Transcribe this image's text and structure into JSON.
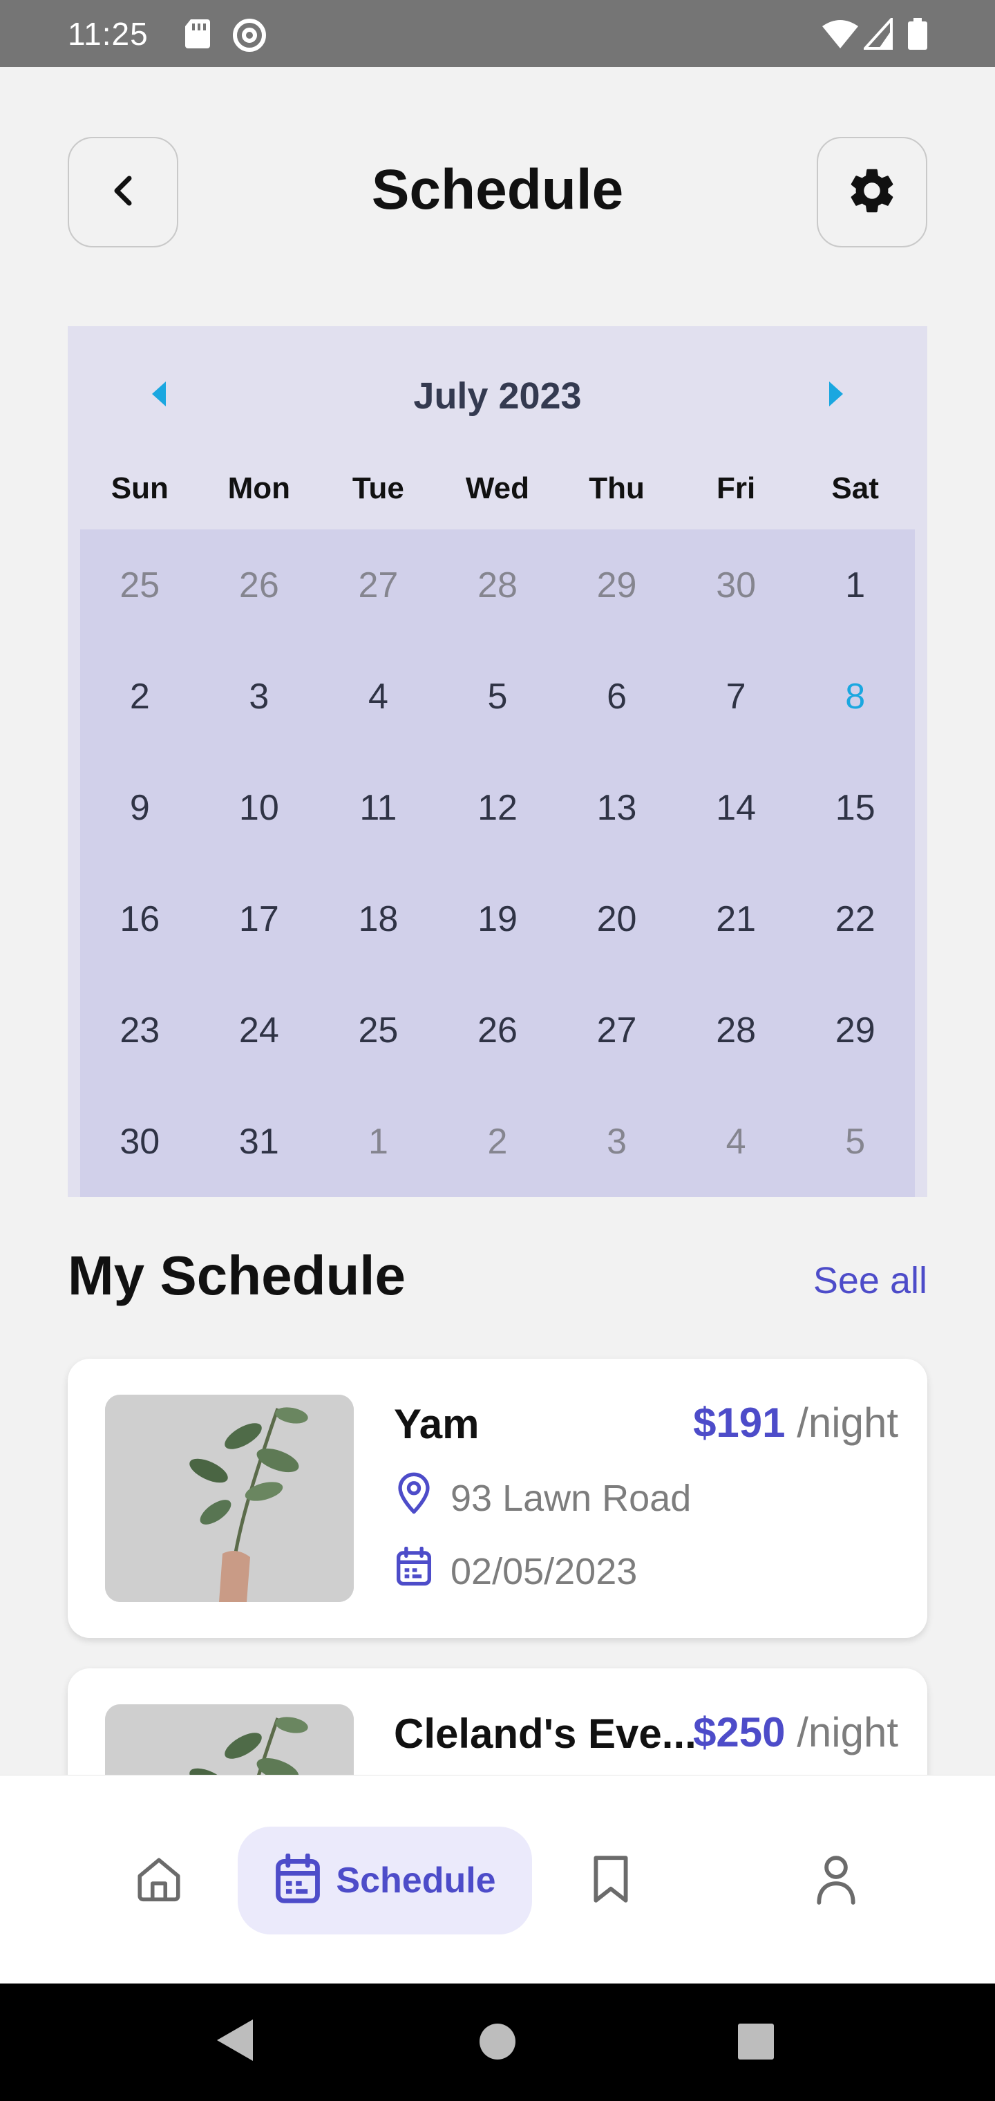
{
  "status_bar": {
    "time": "11:25"
  },
  "header": {
    "title": "Schedule"
  },
  "calendar": {
    "month_label": "July 2023",
    "weekdays": [
      "Sun",
      "Mon",
      "Tue",
      "Wed",
      "Thu",
      "Fri",
      "Sat"
    ],
    "days": [
      [
        "25",
        "26",
        "27",
        "28",
        "29",
        "30",
        "1"
      ],
      [
        "2",
        "3",
        "4",
        "5",
        "6",
        "7",
        "8"
      ],
      [
        "9",
        "10",
        "11",
        "12",
        "13",
        "14",
        "15"
      ],
      [
        "16",
        "17",
        "18",
        "19",
        "20",
        "21",
        "22"
      ],
      [
        "23",
        "24",
        "25",
        "26",
        "27",
        "28",
        "29"
      ],
      [
        "30",
        "31",
        "1",
        "2",
        "3",
        "4",
        "5"
      ]
    ],
    "today": "8",
    "accent_color": "#1aa7e0"
  },
  "my_schedule": {
    "title": "My Schedule",
    "see_all": "See all",
    "items": [
      {
        "name": "Yam",
        "price": "$191",
        "unit": "/night",
        "address": "93 Lawn Road",
        "date": "02/05/2023"
      },
      {
        "name": "Cleland's Eve...",
        "price": "$250",
        "unit": "/night"
      }
    ]
  },
  "bottom_nav": {
    "active_label": "Schedule"
  },
  "colors": {
    "primary": "#4d4cc9",
    "calendar_bg": "#e1e0ef",
    "calendar_grid": "#d1d0ea"
  }
}
